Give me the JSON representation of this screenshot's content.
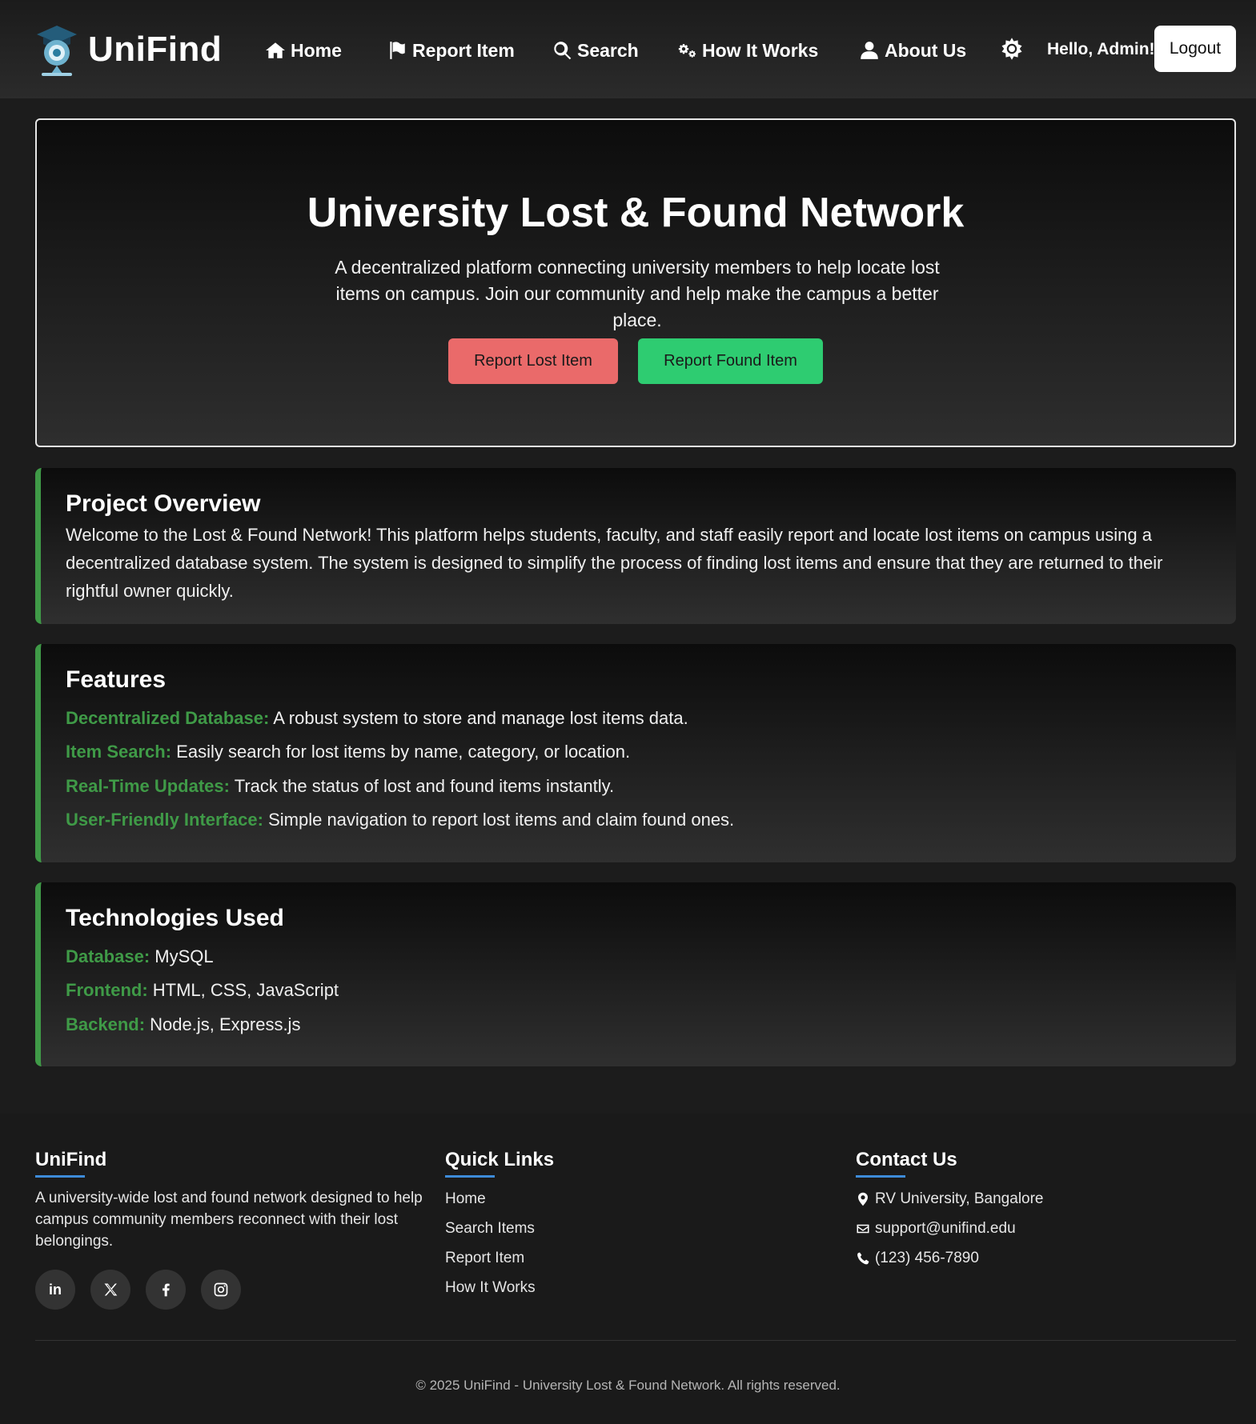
{
  "header": {
    "brand": "UniFind",
    "nav": [
      {
        "label": "Home",
        "icon": "home-icon"
      },
      {
        "label": "Report Item",
        "icon": "flag-icon"
      },
      {
        "label": "Search",
        "icon": "search-icon"
      },
      {
        "label": "How It Works",
        "icon": "gears-icon"
      },
      {
        "label": "About Us",
        "icon": "user-icon"
      }
    ],
    "theme_icon": "sun-icon",
    "greeting": "Hello, Admin!",
    "logout_label": "Logout"
  },
  "hero": {
    "title": "University Lost & Found Network",
    "description": "A decentralized platform connecting university members to help locate lost items on campus. Join our community and help make the campus a better place.",
    "report_lost_label": "Report Lost Item",
    "report_found_label": "Report Found Item"
  },
  "overview": {
    "title": "Project Overview",
    "text": "Welcome to the Lost & Found Network! This platform helps students, faculty, and staff easily report and locate lost items on campus using a decentralized database system. The system is designed to simplify the process of finding lost items and ensure that they are returned to their rightful owner quickly."
  },
  "features": {
    "title": "Features",
    "items": [
      {
        "label": "Decentralized Database:",
        "text": " A robust system to store and manage lost items data."
      },
      {
        "label": "Item Search:",
        "text": " Easily search for lost items by name, category, or location."
      },
      {
        "label": "Real-Time Updates:",
        "text": " Track the status of lost and found items instantly."
      },
      {
        "label": "User-Friendly Interface:",
        "text": " Simple navigation to report lost items and claim found ones."
      }
    ]
  },
  "technologies": {
    "title": "Technologies Used",
    "items": [
      {
        "label": "Database:",
        "text": " MySQL"
      },
      {
        "label": "Frontend:",
        "text": " HTML, CSS, JavaScript"
      },
      {
        "label": "Backend:",
        "text": " Node.js, Express.js"
      }
    ]
  },
  "footer": {
    "about_heading": "UniFind",
    "about_text": "A university-wide lost and found network designed to help campus community members reconnect with their lost belongings.",
    "social": [
      "linkedin-icon",
      "x-icon",
      "facebook-icon",
      "instagram-icon"
    ],
    "social_linkedin_text": "in",
    "links_heading": "Quick Links",
    "links": [
      "Home",
      "Search Items",
      "Report Item",
      "How It Works"
    ],
    "contact_heading": "Contact Us",
    "contact": [
      {
        "icon": "location-pin-icon",
        "text": "RV University, Bangalore"
      },
      {
        "icon": "envelope-icon",
        "text": "support@unifind.edu"
      },
      {
        "icon": "phone-icon",
        "text": "(123) 456-7890"
      }
    ],
    "copyright": "© 2025 UniFind - University Lost & Found Network. All rights reserved."
  },
  "colors": {
    "accent_green": "#3f9a47",
    "lost_button": "#ea6a6a",
    "found_button": "#2ecc71",
    "footer_underline": "#3d8bd9"
  }
}
